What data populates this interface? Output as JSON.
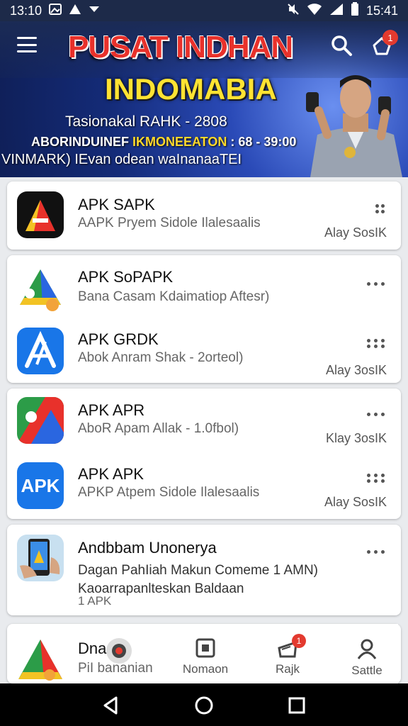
{
  "status_bar": {
    "time_left": "13:10",
    "time_right": "15:41",
    "icons_left": [
      "gallery-icon",
      "drive-icon",
      "signal-arrow-icon"
    ],
    "icons_right": [
      "mute-icon",
      "wifi-icon",
      "cell-signal-icon",
      "battery-icon"
    ]
  },
  "header": {
    "brand": "PUSAT INDHAN",
    "brand_sub": "INDOMABIA",
    "line1": "Tasionakal RAHK - 2808",
    "line2_prefix": "ABORINDUINEF ",
    "line2_highlight": "IKMONEEATON",
    "line2_suffix": " : 68 - 39:00",
    "line3": "VINMARK) IEvan odean waInanaaTEI",
    "notification_count": "1"
  },
  "apps": [
    {
      "title": "APK SAPK",
      "desc": "AAPK Pryem Sidole Ilalesaalis",
      "meta": "Alay SosIK"
    },
    {
      "title": "APK SoPAPK",
      "desc": "Bana Casam Kdaimatiop Aftesr)",
      "meta": ""
    },
    {
      "title": "APK GRDK",
      "desc": "Abok Anram Shak - 2orteol)",
      "meta": "Alay 3osIK"
    },
    {
      "title": "APK APR",
      "desc": "AboR  Apam Allak - 1.0fbol)",
      "meta": "Klay 3osIK"
    },
    {
      "title": "APK APK",
      "desc": "APKP Atpem Sidole Ilalesaalis",
      "meta": "Alay SosIK",
      "icon_text": "APK"
    },
    {
      "title": "Andbbam Unonerya",
      "desc": "Dagan PahIiah Makun Comeme 1 AMN)",
      "desc2": "Kaoarrapanlteskan Baldaan",
      "desc3": "1 APK",
      "meta": ""
    },
    {
      "title": "Dna 76",
      "desc": "PiI bananian",
      "meta": ""
    }
  ],
  "bottom_nav": [
    {
      "label": "Nomaon",
      "icon": "square-home-icon"
    },
    {
      "label": "Rajk",
      "icon": "download-tray-icon",
      "badge": "1"
    },
    {
      "label": "Sattle",
      "icon": "profile-icon"
    }
  ],
  "colors": {
    "status_bg": "#1d2a49",
    "banner_blue": "#2a4ab7",
    "brand_red": "#e8312b",
    "brand_yellow": "#ffe332",
    "badge_red": "#e33a2f",
    "apk_blue": "#1976e8"
  }
}
